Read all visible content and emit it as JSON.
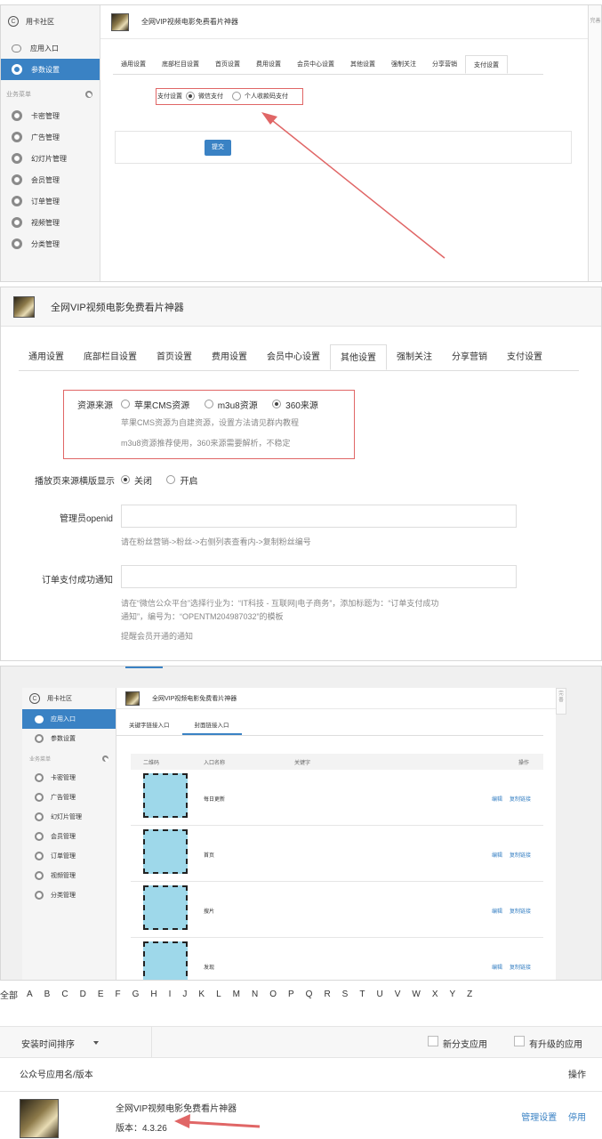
{
  "p1": {
    "brand": "用卡社区",
    "nav": [
      "应用入口",
      "参数设置"
    ],
    "group_title": "业务菜单",
    "menu": [
      "卡密管理",
      "广告管理",
      "幻灯片管理",
      "会员管理",
      "订单管理",
      "视频管理",
      "分类管理"
    ],
    "app_title": "全网VIP视频电影免费看片神器",
    "tabs": [
      "通用设置",
      "底部栏目设置",
      "首页设置",
      "费用设置",
      "会员中心设置",
      "其他设置",
      "强制关注",
      "分享营销",
      "支付设置"
    ],
    "active_tab": "支付设置",
    "pay_label": "支付设置",
    "pay_options": [
      "微信支付",
      "个人收款码支付"
    ],
    "submit": "提交",
    "scroll_text": "完善"
  },
  "p2": {
    "app_title": "全网VIP视频电影免费看片神器",
    "tabs": [
      "通用设置",
      "底部栏目设置",
      "首页设置",
      "费用设置",
      "会员中心设置",
      "其他设置",
      "强制关注",
      "分享营销",
      "支付设置"
    ],
    "active_tab": "其他设置",
    "source_label": "资源来源",
    "source_options": [
      "苹果CMS资源",
      "m3u8资源",
      "360来源"
    ],
    "source_hint1": "苹果CMS资源为自建资源，设置方法请见群内教程",
    "source_hint2": "m3u8资源推荐使用，360来源需要解析，不稳定",
    "landscape_label": "播放页来源横版显示",
    "landscape_options": [
      "关闭",
      "开启"
    ],
    "openid_label": "管理员openid",
    "openid_hint": "请在粉丝营销->粉丝->右侧列表查看内->复制粉丝编号",
    "notify_label": "订单支付成功通知",
    "notify_hint1": "请在“微信公众平台”选择行业为：“IT科技 - 互联网|电子商务”，添加标题为：“订单支付成功",
    "notify_hint2": "通知”，编号为：“OPENTM204987032”的模板",
    "notify_hint3": "提醒会员开通的通知"
  },
  "p3": {
    "brand": "用卡社区",
    "nav": [
      "应用入口",
      "参数设置"
    ],
    "group_title": "业务菜单",
    "menu": [
      "卡密管理",
      "广告管理",
      "幻灯片管理",
      "会员管理",
      "订单管理",
      "视频管理",
      "分类管理"
    ],
    "app_title": "全网VIP视频电影免费看片神器",
    "tabs": [
      "关键字链接入口",
      "封面链接入口"
    ],
    "columns": [
      "二维码",
      "入口名称",
      "关键字",
      "操作"
    ],
    "rows": [
      {
        "name": "每日更新",
        "edit": "编辑",
        "copy": "复制链接"
      },
      {
        "name": "首页",
        "edit": "编辑",
        "copy": "复制链接"
      },
      {
        "name": "搜片",
        "edit": "编辑",
        "copy": "复制链接"
      },
      {
        "name": "发现",
        "edit": "编辑",
        "copy": "复制链接"
      }
    ],
    "scroll_text": "完善"
  },
  "p4": {
    "letters": [
      "全部",
      "A",
      "B",
      "C",
      "D",
      "E",
      "F",
      "G",
      "H",
      "I",
      "J",
      "K",
      "L",
      "M",
      "N",
      "O",
      "P",
      "Q",
      "R",
      "S",
      "T",
      "U",
      "V",
      "W",
      "X",
      "Y",
      "Z"
    ],
    "sort_label": "安装时间排序",
    "new_branch": "新分支应用",
    "upgradable": "有升级的应用",
    "col_name": "公众号应用名/版本",
    "col_action": "操作",
    "app_title": "全网VIP视频电影免费看片神器",
    "version": "版本：4.3.26",
    "manage": "管理设置",
    "disable": "停用"
  },
  "colors": {
    "accent": "#3a82c4",
    "highlight": "#e06666"
  }
}
